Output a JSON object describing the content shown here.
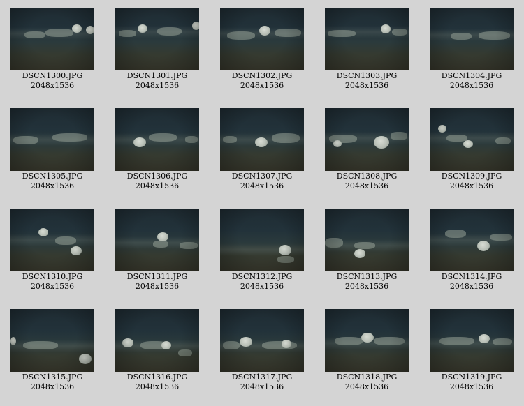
{
  "contact_sheet": {
    "items": [
      {
        "filename": "DSCN1300.JPG",
        "dimensions": "2048x1536"
      },
      {
        "filename": "DSCN1301.JPG",
        "dimensions": "2048x1536"
      },
      {
        "filename": "DSCN1302.JPG",
        "dimensions": "2048x1536"
      },
      {
        "filename": "DSCN1303.JPG",
        "dimensions": "2048x1536"
      },
      {
        "filename": "DSCN1304.JPG",
        "dimensions": "2048x1536"
      },
      {
        "filename": "DSCN1305.JPG",
        "dimensions": "2048x1536"
      },
      {
        "filename": "DSCN1306.JPG",
        "dimensions": "2048x1536"
      },
      {
        "filename": "DSCN1307.JPG",
        "dimensions": "2048x1536"
      },
      {
        "filename": "DSCN1308.JPG",
        "dimensions": "2048x1536"
      },
      {
        "filename": "DSCN1309.JPG",
        "dimensions": "2048x1536"
      },
      {
        "filename": "DSCN1310.JPG",
        "dimensions": "2048x1536"
      },
      {
        "filename": "DSCN1311.JPG",
        "dimensions": "2048x1536"
      },
      {
        "filename": "DSCN1312.JPG",
        "dimensions": "2048x1536"
      },
      {
        "filename": "DSCN1313.JPG",
        "dimensions": "2048x1536"
      },
      {
        "filename": "DSCN1314.JPG",
        "dimensions": "2048x1536"
      },
      {
        "filename": "DSCN1315.JPG",
        "dimensions": "2048x1536"
      },
      {
        "filename": "DSCN1316.JPG",
        "dimensions": "2048x1536"
      },
      {
        "filename": "DSCN1317.JPG",
        "dimensions": "2048x1536"
      },
      {
        "filename": "DSCN1318.JPG",
        "dimensions": "2048x1536"
      },
      {
        "filename": "DSCN1319.JPG",
        "dimensions": "2048x1536"
      }
    ]
  }
}
